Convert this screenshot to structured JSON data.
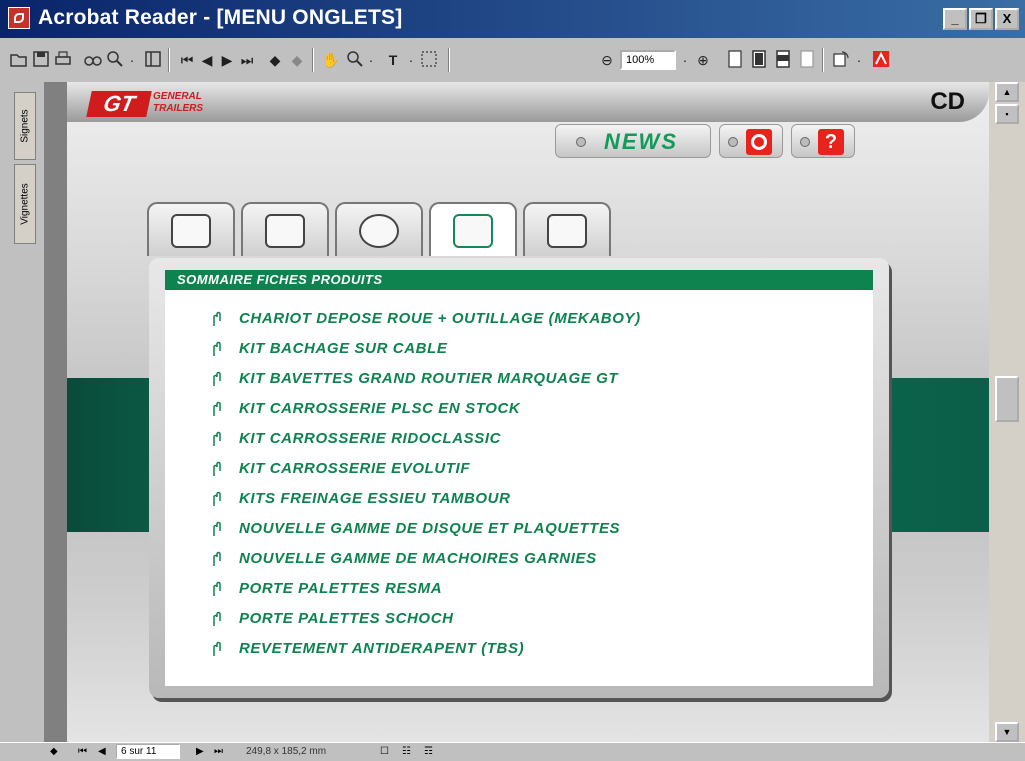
{
  "window": {
    "title": "Acrobat Reader - [MENU ONGLETS]",
    "minimize": "_",
    "restore": "❐",
    "close": "X"
  },
  "toolbar": {
    "zoom": "100%"
  },
  "left_panel": {
    "tabs": [
      "Signets",
      "Vignettes"
    ]
  },
  "page": {
    "logo_gt": "GT",
    "logo_line1": "GENERAL",
    "logo_line2": "TRAILERS",
    "cd_label": "CD",
    "news_label": "NEWS",
    "help_label": "?",
    "panel_title": "SOMMAIRE FICHES PRODUITS",
    "items": [
      "CHARIOT DEPOSE ROUE + OUTILLAGE (MEKABOY)",
      "KIT BACHAGE SUR CABLE",
      "KIT BAVETTES GRAND ROUTIER MARQUAGE GT",
      "KIT CARROSSERIE PLSC EN STOCK",
      "KIT CARROSSERIE RIDOCLASSIC",
      "KIT CARROSSERIE EVOLUTIF",
      "KITS FREINAGE ESSIEU TAMBOUR",
      "NOUVELLE GAMME DE DISQUE ET PLAQUETTES",
      "NOUVELLE GAMME DE MACHOIRES GARNIES",
      "PORTE PALETTES RESMA",
      "PORTE PALETTES SCHOCH",
      "REVETEMENT ANTIDERAPENT (TBS)"
    ]
  },
  "status": {
    "page": "6 sur 11",
    "size": "249,8 x 185,2 mm"
  },
  "colors": {
    "accent_green": "#0e8350",
    "title_blue": "#0a246a",
    "brand_red": "#d01c1c"
  }
}
